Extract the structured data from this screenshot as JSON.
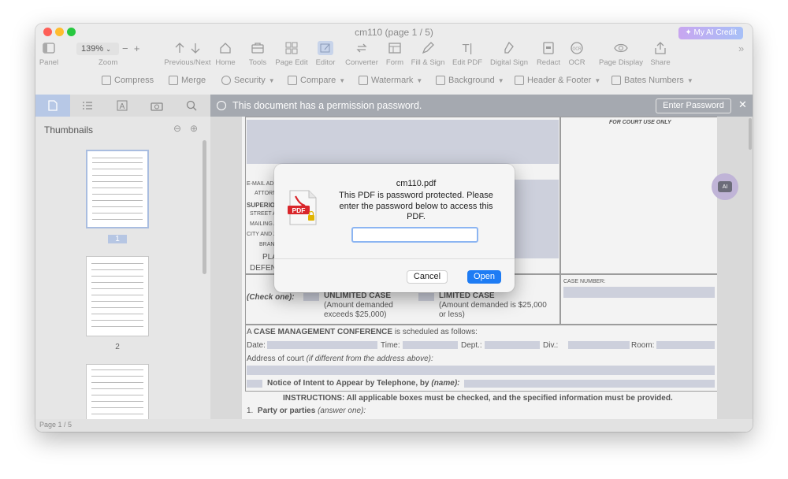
{
  "window": {
    "title": "cm110 (page 1 / 5)"
  },
  "credit": {
    "label": "My AI Credit"
  },
  "toolbar": {
    "zoom_value": "139%",
    "zoom_label": "Zoom",
    "zoom_minus": "−",
    "zoom_plus": "+",
    "items": [
      {
        "label": "Panel",
        "icon": "panel-icon"
      },
      {
        "label": "Previous/Next",
        "icon": "arrows-icon"
      },
      {
        "label": "Home",
        "icon": "home-icon"
      },
      {
        "label": "Tools",
        "icon": "tools-icon"
      },
      {
        "label": "Page Edit",
        "icon": "page-edit-icon"
      },
      {
        "label": "Editor",
        "icon": "editor-icon"
      },
      {
        "label": "Converter",
        "icon": "converter-icon"
      },
      {
        "label": "Form",
        "icon": "form-icon"
      },
      {
        "label": "Fill & Sign",
        "icon": "fill-sign-icon"
      },
      {
        "label": "Edit PDF",
        "icon": "edit-pdf-icon"
      },
      {
        "label": "Digital Sign",
        "icon": "digital-sign-icon"
      },
      {
        "label": "Redact",
        "icon": "redact-icon"
      },
      {
        "label": "OCR",
        "icon": "ocr-icon"
      },
      {
        "label": "Page Display",
        "icon": "eye-icon"
      },
      {
        "label": "Share",
        "icon": "share-icon"
      }
    ]
  },
  "toolbar2": {
    "items": [
      {
        "label": "Compress"
      },
      {
        "label": "Merge"
      },
      {
        "label": "Security"
      },
      {
        "label": "Compare"
      },
      {
        "label": "Watermark"
      },
      {
        "label": "Background"
      },
      {
        "label": "Header & Footer"
      },
      {
        "label": "Bates Numbers"
      }
    ]
  },
  "sidebar": {
    "title": "Thumbnails",
    "pages": [
      "1",
      "2"
    ]
  },
  "banner": {
    "text": "This document has a permission password.",
    "button": "Enter Password",
    "close": "✕"
  },
  "document": {
    "court_use": "FOR COURT USE ONLY",
    "email": "E-MAIL ADD",
    "attorney": "ATTORN",
    "superior": "SUPERIO",
    "street": "STREET A",
    "mailing": "MAILING A",
    "city": "CITY AND Z",
    "branch": "BRAN",
    "plaintiff": "PLA",
    "defendant": "DEFEND",
    "check_one": "(Check one):",
    "unlimited": "UNLIMITED CASE",
    "unlimited_sub1": "(Amount demanded",
    "unlimited_sub2": "exceeds $25,000)",
    "limited": "LIMITED CASE",
    "limited_sub1": "(Amount demanded is $25,000",
    "limited_sub2": "or less)",
    "case_number": "CASE NUMBER:",
    "cmc_prefix": "A",
    "cmc_bold": "CASE MANAGEMENT CONFERENCE",
    "cmc_suffix": "is scheduled as follows:",
    "date": "Date:",
    "time": "Time:",
    "dept": "Dept.:",
    "div": "Div.:",
    "room": "Room:",
    "address": "Address of court",
    "address_italic": "(if different from the address above):",
    "notice": "Notice of Intent to Appear by Telephone, by",
    "notice_italic": "(name):",
    "instructions": "INSTRUCTIONS: All applicable boxes must be checked, and the specified information must be provided.",
    "party_num": "1.",
    "party": "Party or parties",
    "party_italic": "(answer one):"
  },
  "status": {
    "page": "Page 1 / 5"
  },
  "dialog": {
    "title": "cm110.pdf",
    "message": "This PDF is password protected. Please enter the password below to access this PDF.",
    "password_value": "",
    "cancel": "Cancel",
    "open": "Open",
    "icon_text": "PDF"
  },
  "colors": {
    "accent": "#1e7cf4",
    "banner": "#a5a9b0",
    "pdf_red": "#d9252a"
  }
}
